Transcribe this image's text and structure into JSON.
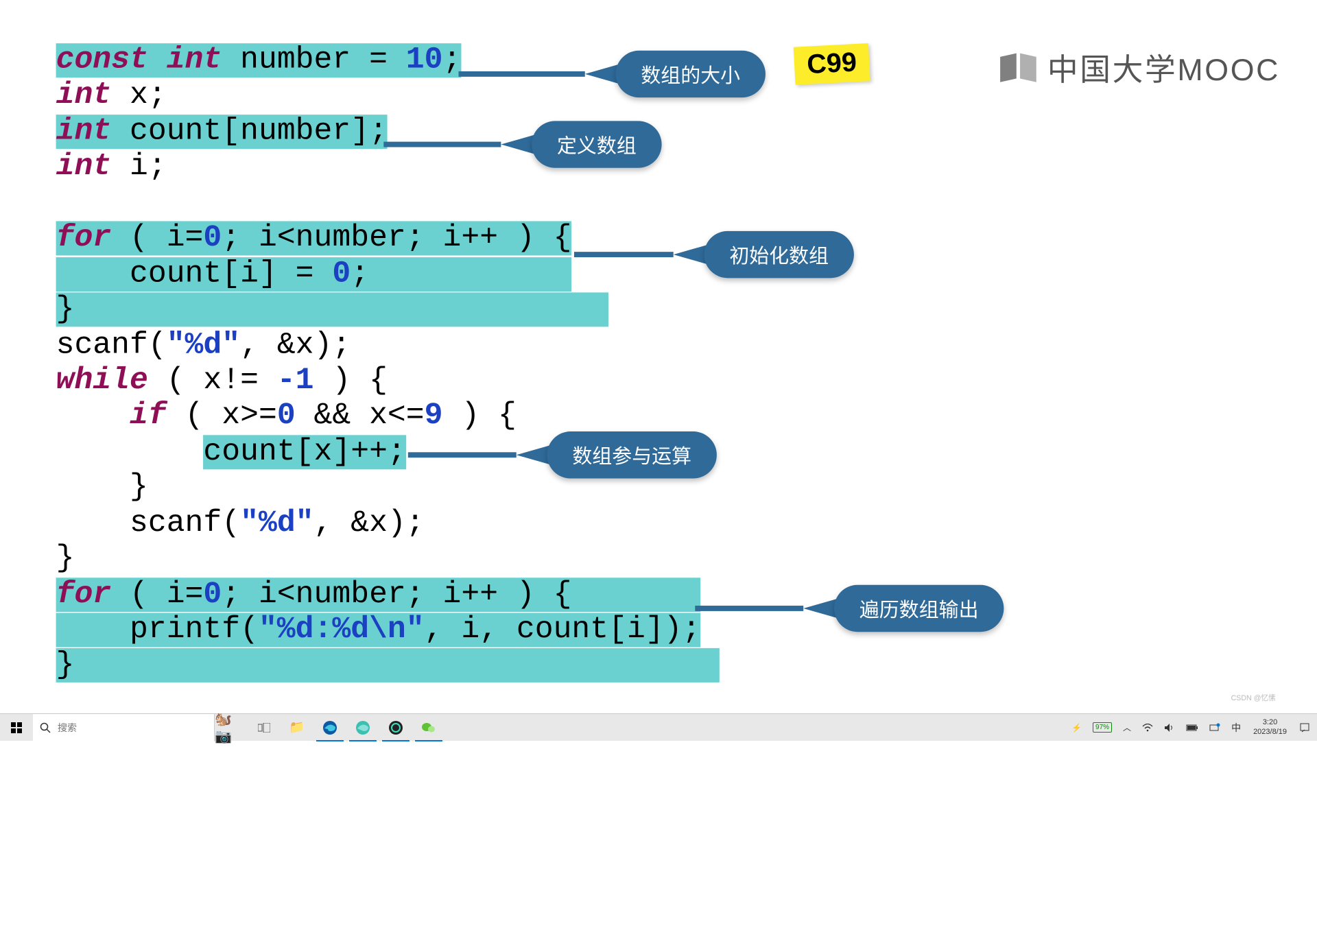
{
  "brand": "中国大学MOOC",
  "tag": "C99",
  "code": {
    "l1": "const int number = 10;",
    "l1_a": "const int",
    "l1_b": " number = ",
    "l1_c": "10",
    "l1_d": ";",
    "l2_a": "int",
    "l2_b": " x;",
    "l3_a": "int",
    "l3_b": " count[number];",
    "l4_a": "int",
    "l4_b": " i;",
    "blank": "",
    "l6_a": "for",
    "l6_b": " ( i=",
    "l6_c": "0",
    "l6_d": "; i<number; i++ ) {",
    "l7_a": "    count[i] = ",
    "l7_b": "0",
    "l7_c": ";",
    "l8": "}",
    "l9_a": "scanf(",
    "l9_b": "\"%d\"",
    "l9_c": ", &x);",
    "l10_a": "while",
    "l10_b": " ( x!= ",
    "l10_c": "-1",
    "l10_d": " ) {",
    "l11_a": "    ",
    "l11_b": "if",
    "l11_c": " ( x>=",
    "l11_d": "0",
    "l11_e": " && x<=",
    "l11_f": "9",
    "l11_g": " ) {",
    "l12_a": "        ",
    "l12_b": "count[x]++;",
    "l13": "    }",
    "l14_a": "    scanf(",
    "l14_b": "\"%d\"",
    "l14_c": ", &x);",
    "l15": "}",
    "l16_a": "for",
    "l16_b": " ( i=",
    "l16_c": "0",
    "l16_d": "; i<number; i++ ) {",
    "l17_a": "    printf(",
    "l17_b": "\"%d:%d\\n\"",
    "l17_c": ", i, count[i]);",
    "l18": "}"
  },
  "callouts": {
    "c1": "数组的大小",
    "c2": "定义数组",
    "c3": "初始化数组",
    "c4": "数组参与运算",
    "c5": "遍历数组输出"
  },
  "taskbar": {
    "search_placeholder": "搜索",
    "battery": "97%",
    "ime": "中",
    "time": "3:20",
    "date": "2023/8/19"
  },
  "watermark": "CSDN @忆愫"
}
